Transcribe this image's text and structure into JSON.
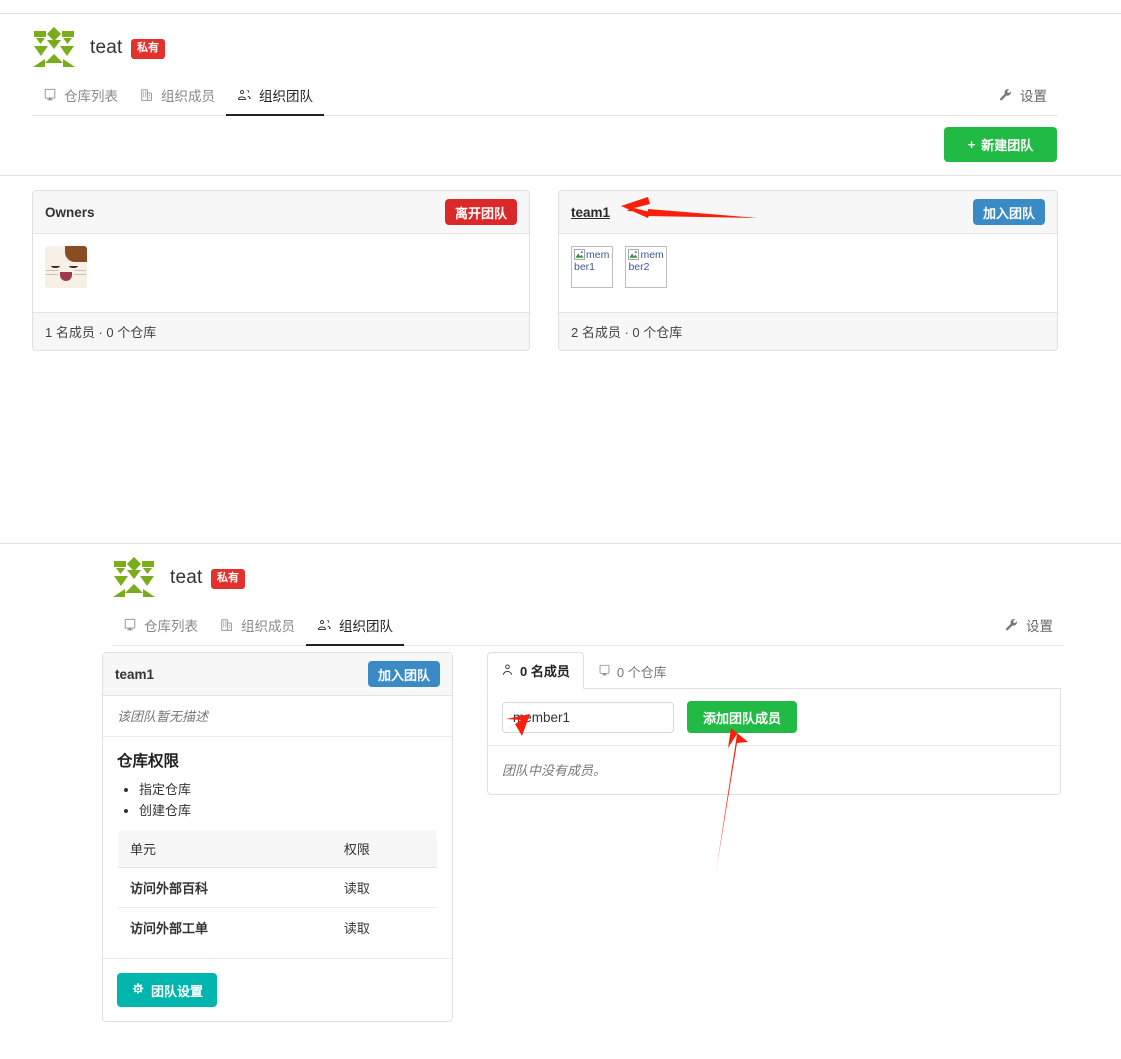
{
  "org": {
    "name": "teat",
    "visibility_badge": "私有",
    "avatar_icon": "identicon-avatar"
  },
  "nav": {
    "tabs": [
      {
        "label": "仓库列表",
        "icon": "repo-icon",
        "active": false
      },
      {
        "label": "组织成员",
        "icon": "organization-icon",
        "active": false
      },
      {
        "label": "组织团队",
        "icon": "team-icon",
        "active": true
      }
    ],
    "settings_label": "设置",
    "settings_icon": "wrench-icon"
  },
  "top_panel": {
    "new_team_button": "新建团队",
    "new_team_icon": "plus-icon",
    "teams": [
      {
        "name": "Owners",
        "is_link": false,
        "action_label": "离开团队",
        "action_style": "red",
        "members": [
          {
            "type": "image",
            "alt": "owner-avatar"
          }
        ],
        "footer": "1 名成员 · 0 个仓库"
      },
      {
        "name": "team1",
        "is_link": true,
        "action_label": "加入团队",
        "action_style": "blue",
        "members": [
          {
            "type": "broken",
            "alt": "member1"
          },
          {
            "type": "broken",
            "alt": "member2"
          }
        ],
        "footer": "2 名成员 · 0 个仓库"
      }
    ]
  },
  "bottom_panel": {
    "team": {
      "name": "team1",
      "action_label": "加入团队",
      "description_empty": "该团队暂无描述",
      "permissions_title": "仓库权限",
      "permissions": [
        "指定仓库",
        "创建仓库"
      ],
      "units_table": {
        "headers": [
          "单元",
          "权限"
        ],
        "rows": [
          {
            "unit": "访问外部百科",
            "permission": "读取"
          },
          {
            "unit": "访问外部工单",
            "permission": "读取"
          }
        ]
      },
      "settings_button": "团队设置",
      "settings_icon": "gear-icon"
    },
    "members_panel": {
      "tabs": [
        {
          "label": "0 名成员",
          "icon": "user-icon",
          "active": true
        },
        {
          "label": "0 个仓库",
          "icon": "repo-icon",
          "active": false
        }
      ],
      "member_input_value": "member1",
      "member_input_placeholder": "",
      "add_member_button": "添加团队成员",
      "empty_note": "团队中没有成员。"
    }
  },
  "annotations": {
    "arrow_color": "#f81f0c",
    "arrows": [
      {
        "name": "arrow-to-team1-link"
      },
      {
        "name": "arrow-to-member-input"
      },
      {
        "name": "arrow-to-add-member-button"
      }
    ]
  },
  "colors": {
    "green": "#21ba45",
    "red": "#db2828",
    "blue": "#3a8ac6",
    "teal": "#00b5ad",
    "badge_red": "#e1322d",
    "identicon_green": "#7aac1c"
  }
}
